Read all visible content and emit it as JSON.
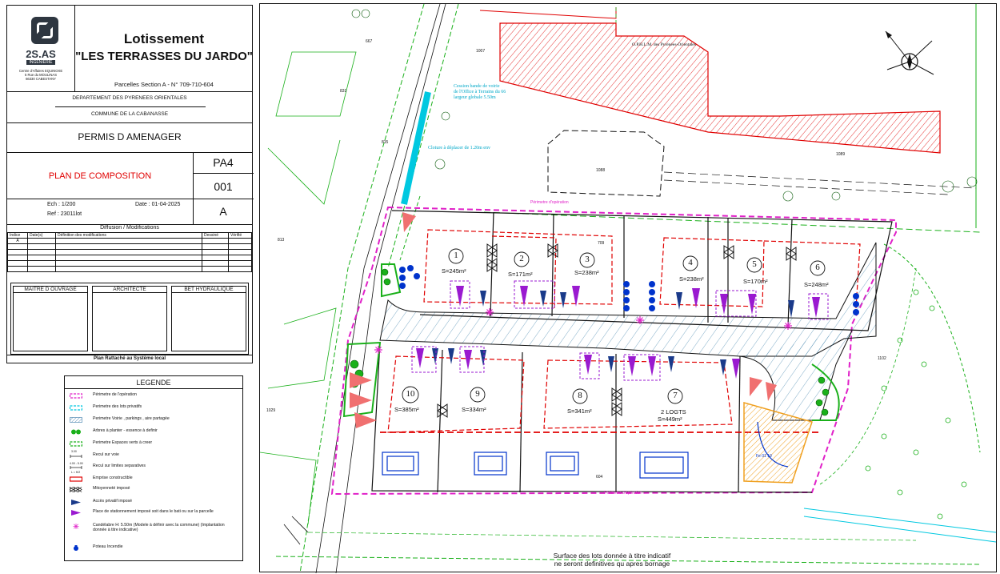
{
  "title_block": {
    "company_short": "2S.AS",
    "company_tag": "INGENIERIE",
    "company_addr": [
      "Centre d'Affaires EQUINOXE",
      "5 Rue du MOULINAS",
      "66330 CABESTANY"
    ],
    "project_title": "Lotissement",
    "project_name": "\"LES TERRASSES DU JARDO\"",
    "parcels": "Parcelles Section A - N° 709-710-604",
    "department": "DEPARTEMENT DES PYRENEES ORIENTALES",
    "commune": "COMMUNE DE LA CABANASSE",
    "permit": "PERMIS D AMENAGER",
    "plan_name": "PLAN DE COMPOSITION",
    "pa_code": "PA4",
    "plan_number": "001",
    "revision": "A",
    "scale": "Ech : 1/200",
    "date": "Date : 01-04-2025",
    "ref": "Ref : 23011lot",
    "diffusion_title": "Diffusion / Modifications",
    "mod_headers": [
      "Indice",
      "Date(s)",
      "Définition des modifications",
      "Dessiné",
      "Vérifié"
    ],
    "mod_first_index": "A",
    "roles": [
      "MAITRE D OUVRAGE",
      "ARCHITECTE",
      "BET HYDRAULIQUE"
    ],
    "footer": "Plan Rattaché au Système local"
  },
  "legend": {
    "title": "LEGENDE",
    "items": [
      {
        "label": "Périmetre de l'opération",
        "symbol": "dash-magenta"
      },
      {
        "label": "Perimetre des lots privatifs",
        "symbol": "dash-cyan"
      },
      {
        "label": "Perimetre Voirie , parkings , aire partagée",
        "symbol": "hatch-blue"
      },
      {
        "label": "Arbres à planter - essence à definir",
        "symbol": "tree-icon"
      },
      {
        "label": "Perimetre Espaces verts à creer",
        "symbol": "dash-green"
      },
      {
        "label": "Recul sur voie",
        "symbol": "dim-line"
      },
      {
        "label": "Recul sur limites separatives",
        "symbol": "dim-line-2"
      },
      {
        "label": "Emprise constructible",
        "symbol": "solid-red"
      },
      {
        "label": "Mitoyenneté imposé",
        "symbol": "bowtie-icon"
      },
      {
        "label": "Accès privatif imposé",
        "symbol": "flag-icon"
      },
      {
        "label": "Place de stationnement imposé soit dans le bati ou sur la parcelle",
        "symbol": "triangle-purple"
      },
      {
        "label": "Candélabre H: 5.50m (Modele à définir avec la commune) (Implantation donnée à titre indicative)",
        "symbol": "star-icon"
      },
      {
        "label": "Poteau Incendie",
        "symbol": "hydrant-icon"
      }
    ],
    "recul_small_labels": [
      "3.00",
      "4.00 - 5.00",
      "L = H/2"
    ]
  },
  "map": {
    "note_line1": "Surface des lots donnée à titre indicatif",
    "note_line2": "ne seront definitives qu apres bornage",
    "ophlm": "O.P.H.L.M. des Pyrénées-Orientales",
    "cession": [
      "Cession bande de voirie",
      "de l'Office à Terrains du 66",
      "largeur globale 5.50m"
    ],
    "cloture": "Cloture à déplacer de 1.20m env",
    "perimetre_label": "Périmetre d'opération",
    "lots": [
      {
        "num": "1",
        "area": "S=245m²"
      },
      {
        "num": "2",
        "area": "S=171m²"
      },
      {
        "num": "3",
        "area": "S=238m²"
      },
      {
        "num": "4",
        "area": "S=238m²"
      },
      {
        "num": "5",
        "area": "S=170m²"
      },
      {
        "num": "6",
        "area": "S=248m²"
      },
      {
        "num": "7",
        "extra": "2 LOGTS",
        "area": "S=449m²"
      },
      {
        "num": "8",
        "area": "S=341m²"
      },
      {
        "num": "9",
        "area": "S=334m²"
      },
      {
        "num": "10",
        "area": "S=385m²"
      }
    ],
    "parcel_numbers": [
      "667",
      "831",
      "1007",
      "1088",
      "1089",
      "1029",
      "813",
      "815",
      "604",
      "709",
      "1102"
    ],
    "basin_label": "Fe 01 10",
    "colors": {
      "magenta": "#e020c8",
      "cyan": "#00c8e0",
      "red": "#e00000",
      "green": "#1ab01a",
      "purple": "#9a1ad0",
      "navy": "#1a3a8a",
      "orange": "#f0a020",
      "blue": "#0033cc"
    }
  }
}
